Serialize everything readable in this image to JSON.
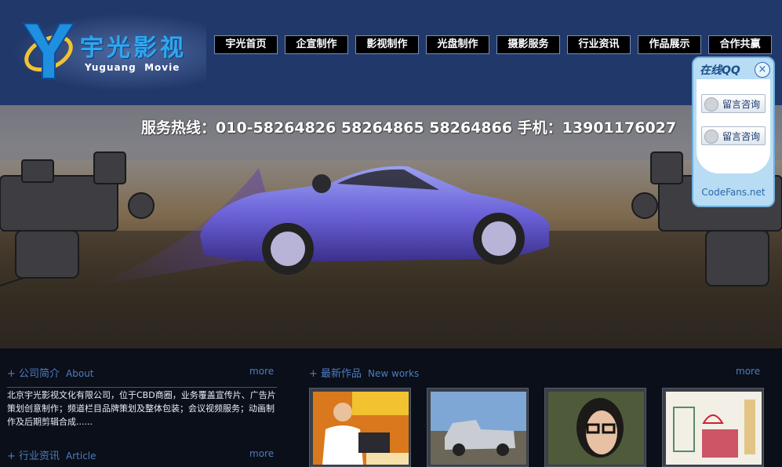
{
  "site": {
    "logo_cn": "宇光影视",
    "logo_en": "Yuguang  Movie"
  },
  "nav": {
    "items": [
      {
        "label": "宇光首页"
      },
      {
        "label": "企宣制作"
      },
      {
        "label": "影视制作"
      },
      {
        "label": "光盘制作"
      },
      {
        "label": "摄影服务"
      },
      {
        "label": "行业资讯"
      },
      {
        "label": "作品展示"
      },
      {
        "label": "合作共赢"
      }
    ]
  },
  "banner": {
    "hotline": "服务热线：010-58264826 58264865 58264866   手机：13901176027"
  },
  "qq_widget": {
    "title": "在线QQ",
    "close_glyph": "×",
    "buttons": [
      {
        "label": "留言咨询"
      },
      {
        "label": "留言咨询"
      }
    ],
    "footer": "CodeFans.net"
  },
  "about": {
    "title": "+ 公司简介",
    "title_en": "About",
    "more": "more",
    "text": "北京宇光影视文化有限公司，位于CBD商圈，业务覆盖宣传片、广告片策划创意制作；频道栏目品牌策划及整体包装；会议视频服务；动画制作及后期剪辑合成......"
  },
  "news": {
    "title": "+ 行业资讯",
    "title_en": "Article",
    "more": "more"
  },
  "works": {
    "title": "+ 最新作品",
    "title_en": "New works",
    "more": "more",
    "thumbnails": [
      {
        "icon": "presenter-thumbnail"
      },
      {
        "icon": "pickup-truck-thumbnail"
      },
      {
        "icon": "woman-glasses-thumbnail"
      },
      {
        "icon": "drawing-thumbnail"
      }
    ]
  },
  "colors": {
    "header_bg": "#21386a",
    "nav_bg": "#000000",
    "accent_blue": "#4f7cc0",
    "logo_blue": "#2fa7ef"
  }
}
